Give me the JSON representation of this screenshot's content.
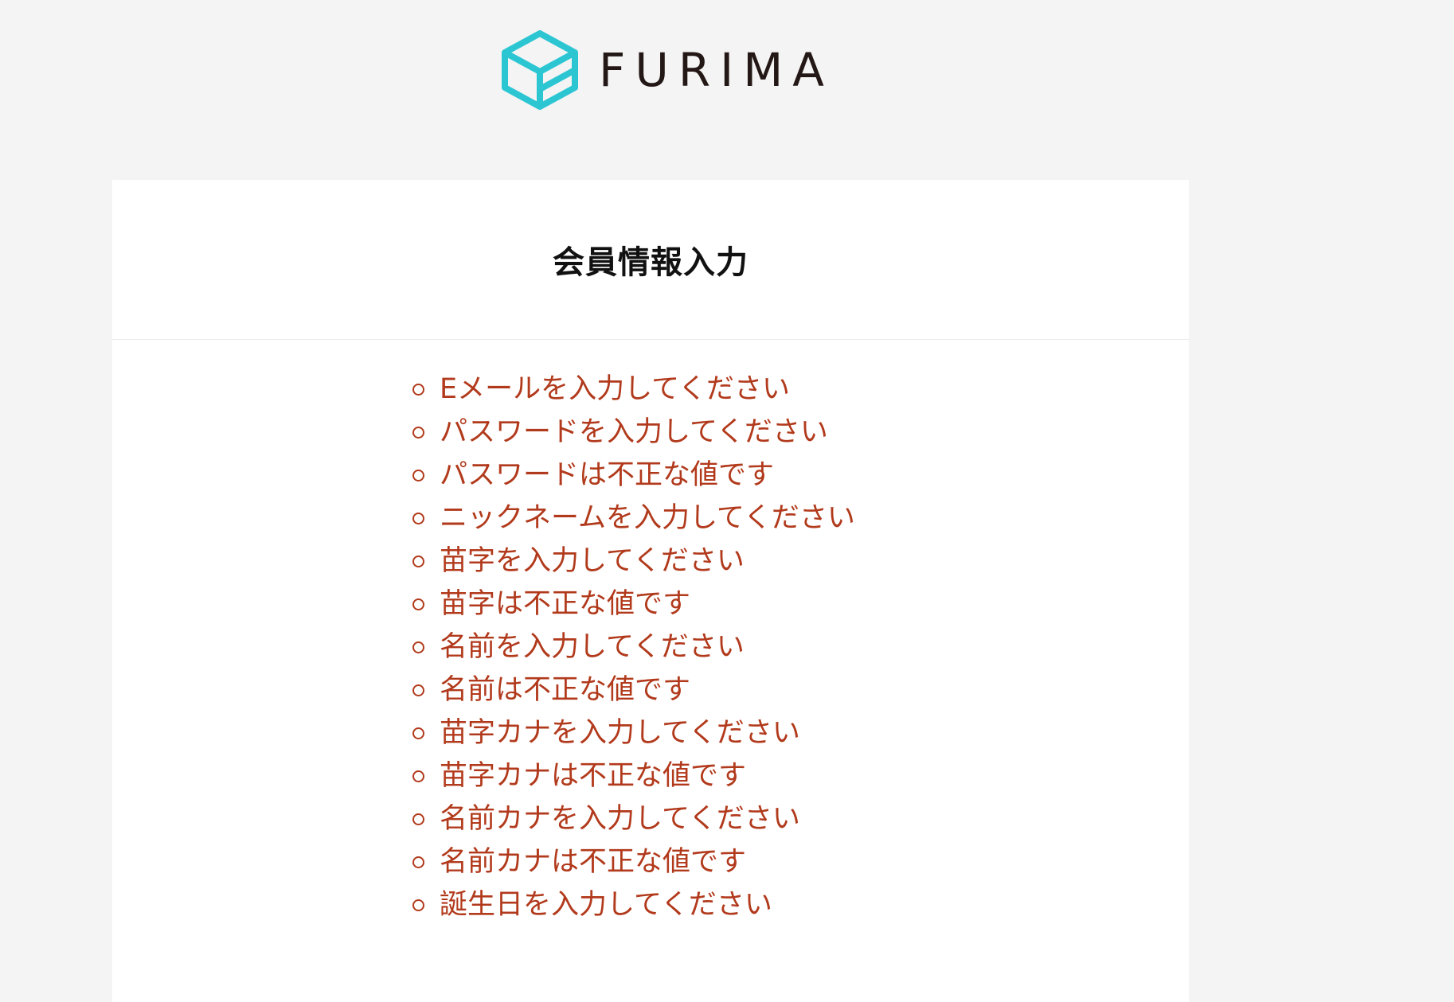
{
  "header": {
    "logo_text": "FURIMA",
    "logo_icon": "box-logo-icon",
    "brand_color": "#2cc6d3"
  },
  "page": {
    "title": "会員情報入力"
  },
  "errors": [
    "Eメールを入力してください",
    "パスワードを入力してください",
    "パスワードは不正な値です",
    "ニックネームを入力してください",
    "苗字を入力してください",
    "苗字は不正な値です",
    "名前を入力してください",
    "名前は不正な値です",
    "苗字カナを入力してください",
    "苗字カナは不正な値です",
    "名前カナを入力してください",
    "名前カナは不正な値です",
    "誕生日を入力してください"
  ],
  "colors": {
    "background": "#f4f4f4",
    "card": "#ffffff",
    "error_text": "#b23a1c",
    "title_text": "#111111"
  }
}
